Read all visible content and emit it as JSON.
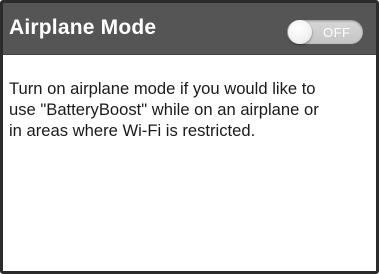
{
  "header": {
    "title": "Airplane Mode",
    "toggle": {
      "state_label": "OFF",
      "enabled": false
    }
  },
  "description": {
    "lines": [
      "Turn on airplane mode if you would like to",
      "use \"BatteryBoost\" while on an airplane or",
      "in areas where Wi-Fi is restricted."
    ]
  },
  "colors": {
    "header_bg": "#555555",
    "border": "#2b2b2b",
    "toggle_track": "#c8c8c8",
    "text": "#1a1a1a"
  }
}
